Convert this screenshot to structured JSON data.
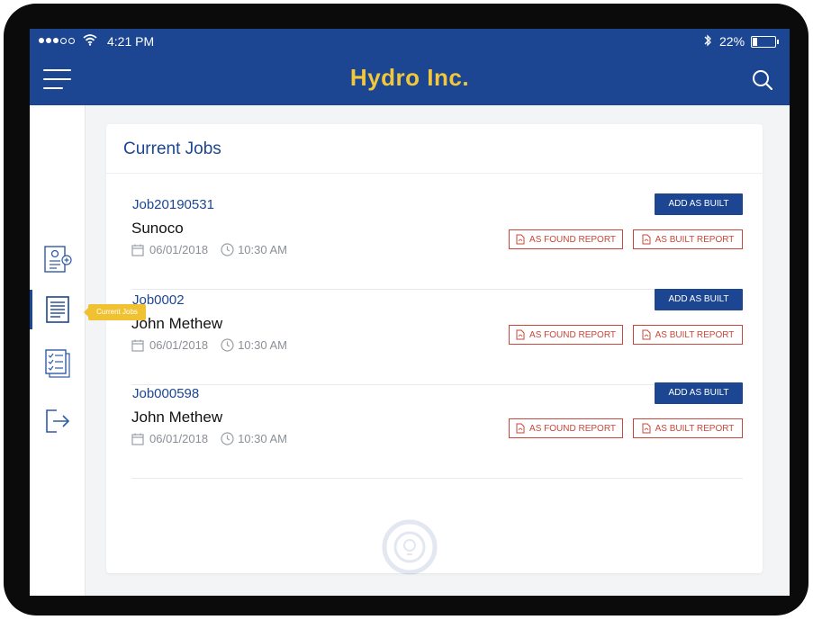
{
  "status_bar": {
    "time": "4:21 PM",
    "battery_percent": "22%"
  },
  "header": {
    "title": "Hydro Inc.",
    "brand_color": "#1c4691",
    "title_color": "#f3c73a"
  },
  "sidebar": {
    "items": [
      {
        "icon": "add-user-document-icon",
        "active": false
      },
      {
        "icon": "document-list-icon",
        "active": true,
        "tooltip": "Current Jobs"
      },
      {
        "icon": "checklist-icon",
        "active": false
      },
      {
        "icon": "logout-icon",
        "active": false
      }
    ]
  },
  "main": {
    "section_title": "Current Jobs",
    "jobs": [
      {
        "id": "Job20190531",
        "customer": "Sunoco",
        "date": "06/01/2018",
        "time": "10:30 AM",
        "add_button": "ADD AS BUILT",
        "found_report": "AS FOUND REPORT",
        "built_report": "AS BUILT REPORT"
      },
      {
        "id": "Job0002",
        "customer": "John Methew",
        "date": "06/01/2018",
        "time": "10:30 AM",
        "add_button": "ADD AS BUILT",
        "found_report": "AS FOUND REPORT",
        "built_report": "AS BUILT REPORT"
      },
      {
        "id": "Job000598",
        "customer": "John Methew",
        "date": "06/01/2018",
        "time": "10:30 AM",
        "add_button": "ADD AS BUILT",
        "found_report": "AS FOUND REPORT",
        "built_report": "AS BUILT REPORT"
      }
    ]
  },
  "colors": {
    "report_red": "#c9463a",
    "tooltip_yellow": "#f0c232"
  }
}
